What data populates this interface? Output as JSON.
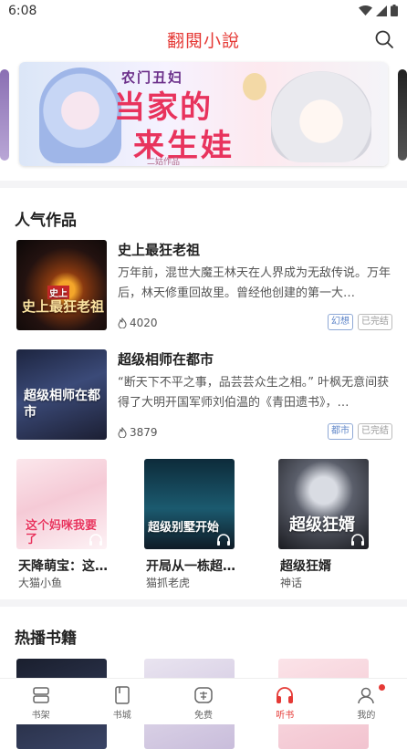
{
  "status": {
    "time": "6:08"
  },
  "app": {
    "title": "翻閱小說",
    "accent": "#e53935"
  },
  "banner": {
    "line1": "农门丑妇",
    "line2": "当家的",
    "line3": "来生娃",
    "small": "二姑作品"
  },
  "popular": {
    "title": "人气作品",
    "books": [
      {
        "name": "史上最狂老祖",
        "desc": "万年前，混世大魔王林天在人界成为无敌传说。万年后，林天修重回故里。曾经他创建的第一大…",
        "count": "4020",
        "tags": [
          "幻想",
          "已完结"
        ],
        "cover_text": "史上最狂老祖",
        "cover_badge": "史上"
      },
      {
        "name": "超级相师在都市",
        "desc": "“断天下不平之事，品芸芸众生之相。” 叶枫无意间获得了大明开国军师刘伯温的《青田遗书》，…",
        "count": "3879",
        "tags": [
          "都市",
          "已完结"
        ],
        "cover_text": "超级相师在都市"
      }
    ],
    "grid": [
      {
        "name": "天降萌宝：这…",
        "author": "大猫小鱼",
        "cover_text": "这个妈咪我要了"
      },
      {
        "name": "开局从一栋超…",
        "author": "猫抓老虎",
        "cover_text": "超级别墅开始"
      },
      {
        "name": "超级狂婿",
        "author": "神话",
        "cover_text": "超级狂婿"
      }
    ]
  },
  "hot": {
    "title": "热播书籍"
  },
  "tabbar": {
    "items": [
      {
        "label": "书架",
        "icon": "bookshelf-icon"
      },
      {
        "label": "书城",
        "icon": "bookstore-icon"
      },
      {
        "label": "免费",
        "icon": "free-icon"
      },
      {
        "label": "听书",
        "icon": "headphones-icon",
        "active": true
      },
      {
        "label": "我的",
        "icon": "profile-icon",
        "badge": true
      }
    ]
  }
}
